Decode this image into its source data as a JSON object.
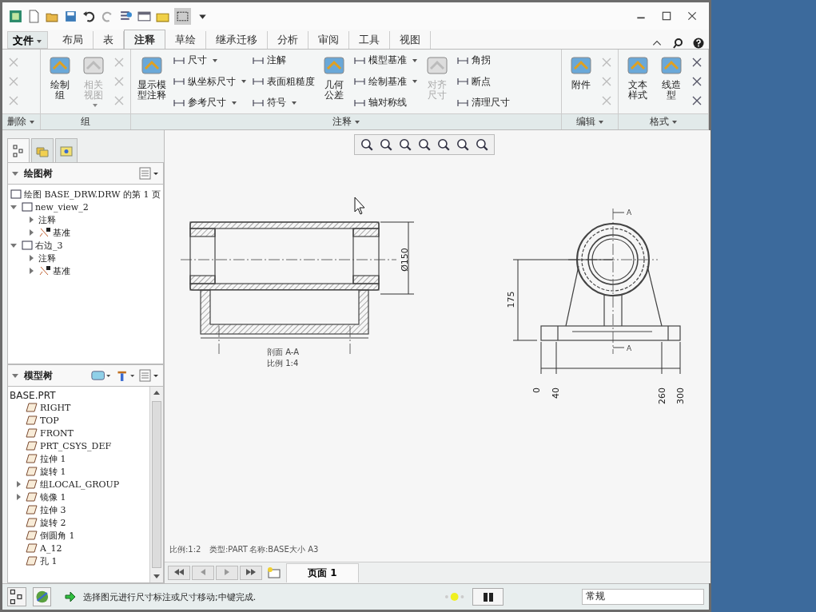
{
  "file_menu": {
    "label": "文件"
  },
  "tabs": [
    {
      "label": "布局",
      "selected": false
    },
    {
      "label": "表",
      "selected": false
    },
    {
      "label": "注释",
      "selected": true
    },
    {
      "label": "草绘",
      "selected": false
    },
    {
      "label": "继承迁移",
      "selected": false
    },
    {
      "label": "分析",
      "selected": false
    },
    {
      "label": "审阅",
      "selected": false
    },
    {
      "label": "工具",
      "selected": false
    },
    {
      "label": "视图",
      "selected": false
    }
  ],
  "ribbon_groups": [
    {
      "label": "删除",
      "menu": true,
      "columns": [
        {
          "kind": "icons",
          "disabled": true
        }
      ]
    },
    {
      "label": "组",
      "menu": false,
      "columns": [
        {
          "kind": "large",
          "label": "绘制组",
          "disabled": false,
          "menu": false
        },
        {
          "kind": "large",
          "label": "相关视图",
          "disabled": true,
          "menu": true
        },
        {
          "kind": "icons",
          "disabled": true
        }
      ]
    },
    {
      "label": "注释",
      "menu": true,
      "columns": [
        {
          "kind": "large",
          "label": "显示模型注释",
          "disabled": false,
          "menu": false
        },
        {
          "kind": "stack",
          "items": [
            {
              "label": "尺寸",
              "menu": true
            },
            {
              "label": "纵坐标尺寸",
              "menu": true
            },
            {
              "label": "参考尺寸",
              "menu": true
            }
          ]
        },
        {
          "kind": "stack",
          "items": [
            {
              "label": "注解",
              "menu": false
            },
            {
              "label": "表面粗糙度",
              "menu": false
            },
            {
              "label": "符号",
              "menu": true
            }
          ]
        },
        {
          "kind": "large",
          "label": "几何公差",
          "disabled": false,
          "menu": false
        },
        {
          "kind": "stack",
          "items": [
            {
              "label": "模型基准",
              "menu": true
            },
            {
              "label": "绘制基准",
              "menu": true
            },
            {
              "label": "轴对称线",
              "menu": false
            }
          ]
        },
        {
          "kind": "large",
          "label": "对齐尺寸",
          "disabled": true,
          "menu": false
        },
        {
          "kind": "stack",
          "items": [
            {
              "label": "角拐",
              "menu": false
            },
            {
              "label": "断点",
              "menu": false
            },
            {
              "label": "清理尺寸",
              "menu": false
            }
          ]
        }
      ]
    },
    {
      "label": "编辑",
      "menu": true,
      "columns": [
        {
          "kind": "large",
          "label": "附件",
          "disabled": false,
          "menu": false
        },
        {
          "kind": "icons",
          "disabled": true
        }
      ]
    },
    {
      "label": "格式",
      "menu": true,
      "columns": [
        {
          "kind": "large",
          "label": "文本样式",
          "disabled": false,
          "menu": false
        },
        {
          "kind": "large",
          "label": "线造型",
          "disabled": false,
          "menu": false
        },
        {
          "kind": "icons",
          "disabled": false
        }
      ]
    }
  ],
  "drawing_tree": {
    "title": "绘图树",
    "items": [
      {
        "label": "绘图 BASE_DRW.DRW 的第 1 页"
      },
      {
        "label": "new_view_2",
        "expanded": true,
        "children": [
          {
            "label": "注释",
            "expanded": false
          },
          {
            "label": "基准",
            "expanded": false
          }
        ]
      },
      {
        "label": "右边_3",
        "expanded": true,
        "children": [
          {
            "label": "注释",
            "expanded": false
          },
          {
            "label": "基准",
            "expanded": false
          }
        ]
      }
    ]
  },
  "model_tree": {
    "title": "模型树",
    "root": "BASE.PRT",
    "items": [
      {
        "label": "RIGHT"
      },
      {
        "label": "TOP"
      },
      {
        "label": "FRONT"
      },
      {
        "label": "PRT_CSYS_DEF"
      },
      {
        "label": "拉伸 1"
      },
      {
        "label": "旋转 1"
      },
      {
        "label": "组LOCAL_GROUP",
        "expanded": false
      },
      {
        "label": "镜像 1",
        "expanded": false
      },
      {
        "label": "拉伸 3"
      },
      {
        "label": "旋转 2"
      },
      {
        "label": "倒圆角 1"
      },
      {
        "label": "A_12"
      },
      {
        "label": "孔 1"
      }
    ]
  },
  "drawing": {
    "diameter_dim": "Ø150",
    "height_dim": "175",
    "base_dims": [
      "0",
      "40",
      "260",
      "300"
    ],
    "cutting_plane_labels": [
      "A",
      "A"
    ],
    "section_caption": "剖面 A-A",
    "scale_caption": "比例 1:4",
    "sheet_info": [
      "比例:1:2",
      "类型:PART",
      "名称:BASE",
      "大小 A3"
    ]
  },
  "page_nav": {
    "page_tab": "页面 1"
  },
  "status_bar": {
    "message": "选择图元进行尺寸标注或尺寸移动;中键完成.",
    "filter": "常规"
  }
}
